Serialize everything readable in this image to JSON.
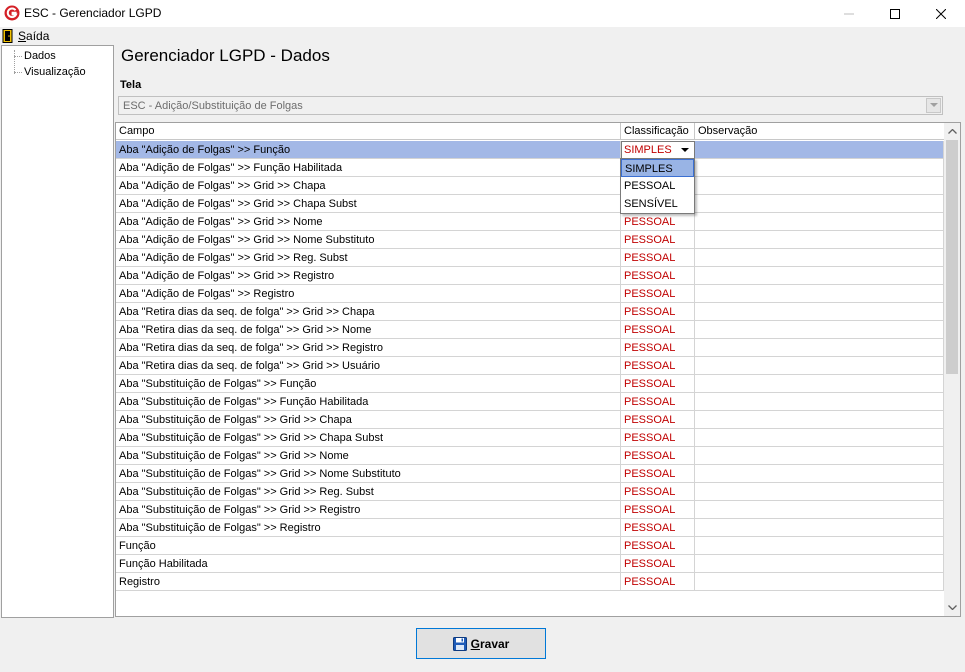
{
  "window": {
    "title": "ESC - Gerenciador LGPD"
  },
  "menu": {
    "saida_first": "S",
    "saida_rest": "aída"
  },
  "sidebar": {
    "items": [
      {
        "label": "Dados"
      },
      {
        "label": "Visualização"
      }
    ]
  },
  "main": {
    "title": "Gerenciador LGPD - Dados",
    "tela_label": "Tela",
    "tela_value": "ESC - Adição/Substituição de Folgas"
  },
  "grid": {
    "columns": [
      "Campo",
      "Classificação",
      "Observação"
    ],
    "editing_value": "SIMPLES",
    "rows": [
      {
        "campo": "Aba \"Adição de Folgas\" >> Função",
        "classificacao": "SIMPLES",
        "observacao": ""
      },
      {
        "campo": "Aba \"Adição de Folgas\" >> Função Habilitada",
        "classificacao": "",
        "observacao": ""
      },
      {
        "campo": "Aba \"Adição de Folgas\" >> Grid >> Chapa",
        "classificacao": "",
        "observacao": ""
      },
      {
        "campo": "Aba \"Adição de Folgas\" >> Grid >> Chapa Subst",
        "classificacao": "",
        "observacao": ""
      },
      {
        "campo": "Aba \"Adição de Folgas\" >> Grid >> Nome",
        "classificacao": "PESSOAL",
        "observacao": ""
      },
      {
        "campo": "Aba \"Adição de Folgas\" >> Grid >> Nome Substituto",
        "classificacao": "PESSOAL",
        "observacao": ""
      },
      {
        "campo": "Aba \"Adição de Folgas\" >> Grid >> Reg. Subst",
        "classificacao": "PESSOAL",
        "observacao": ""
      },
      {
        "campo": "Aba \"Adição de Folgas\" >> Grid >> Registro",
        "classificacao": "PESSOAL",
        "observacao": ""
      },
      {
        "campo": "Aba \"Adição de Folgas\" >> Registro",
        "classificacao": "PESSOAL",
        "observacao": ""
      },
      {
        "campo": "Aba \"Retira dias da seq. de folga\" >> Grid >> Chapa",
        "classificacao": "PESSOAL",
        "observacao": ""
      },
      {
        "campo": "Aba \"Retira dias da seq. de folga\" >> Grid >> Nome",
        "classificacao": "PESSOAL",
        "observacao": ""
      },
      {
        "campo": "Aba \"Retira dias da seq. de folga\" >> Grid >> Registro",
        "classificacao": "PESSOAL",
        "observacao": ""
      },
      {
        "campo": "Aba \"Retira dias da seq. de folga\" >> Grid >> Usuário",
        "classificacao": "PESSOAL",
        "observacao": ""
      },
      {
        "campo": "Aba \"Substituição de Folgas\" >> Função",
        "classificacao": "PESSOAL",
        "observacao": ""
      },
      {
        "campo": "Aba \"Substituição de Folgas\" >> Função Habilitada",
        "classificacao": "PESSOAL",
        "observacao": ""
      },
      {
        "campo": "Aba \"Substituição de Folgas\" >> Grid >> Chapa",
        "classificacao": "PESSOAL",
        "observacao": ""
      },
      {
        "campo": "Aba \"Substituição de Folgas\" >> Grid >> Chapa Subst",
        "classificacao": "PESSOAL",
        "observacao": ""
      },
      {
        "campo": "Aba \"Substituição de Folgas\" >> Grid >> Nome",
        "classificacao": "PESSOAL",
        "observacao": ""
      },
      {
        "campo": "Aba \"Substituição de Folgas\" >> Grid >> Nome Substituto",
        "classificacao": "PESSOAL",
        "observacao": ""
      },
      {
        "campo": "Aba \"Substituição de Folgas\" >> Grid >> Reg. Subst",
        "classificacao": "PESSOAL",
        "observacao": ""
      },
      {
        "campo": "Aba \"Substituição de Folgas\" >> Grid >> Registro",
        "classificacao": "PESSOAL",
        "observacao": ""
      },
      {
        "campo": "Aba \"Substituição de Folgas\" >> Registro",
        "classificacao": "PESSOAL",
        "observacao": ""
      },
      {
        "campo": "Função",
        "classificacao": "PESSOAL",
        "observacao": ""
      },
      {
        "campo": "Função Habilitada",
        "classificacao": "PESSOAL",
        "observacao": ""
      },
      {
        "campo": "Registro",
        "classificacao": "PESSOAL",
        "observacao": ""
      }
    ],
    "dropdown_options": [
      "SIMPLES",
      "PESSOAL",
      "SENSÍVEL"
    ]
  },
  "footer": {
    "gravar_first": "G",
    "gravar_rest": "ravar"
  },
  "colors": {
    "selected_row": "#a3b8e6",
    "classification_text": "#c00000",
    "dropdown_highlight": "#99b4e5"
  }
}
